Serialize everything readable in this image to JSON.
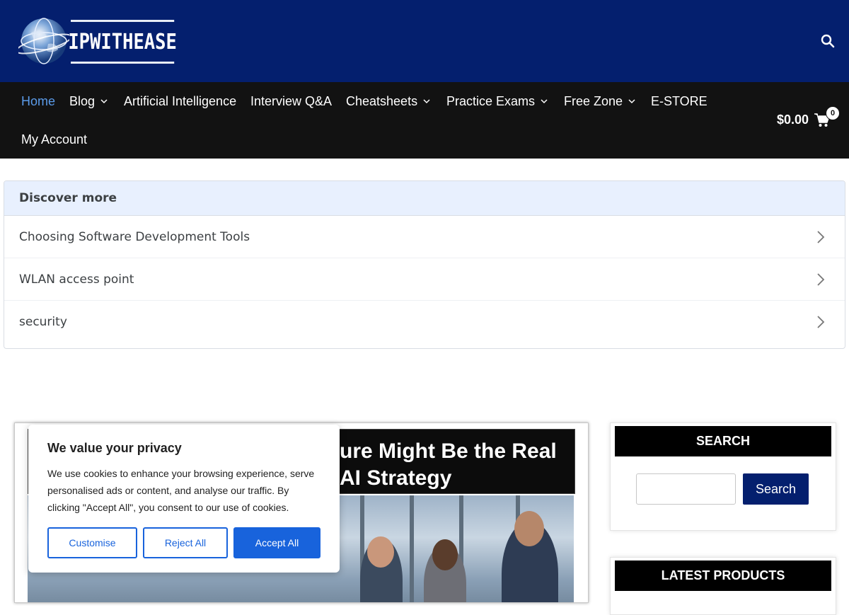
{
  "brand": {
    "name": "IPWITHEASE"
  },
  "nav": {
    "items": [
      {
        "label": "Home",
        "active": true,
        "dropdown": false
      },
      {
        "label": "Blog",
        "dropdown": true
      },
      {
        "label": "Artificial Intelligence",
        "dropdown": false
      },
      {
        "label": "Interview Q&A",
        "dropdown": false
      },
      {
        "label": "Cheatsheets",
        "dropdown": true
      },
      {
        "label": "Practice Exams",
        "dropdown": true
      },
      {
        "label": "Free Zone",
        "dropdown": true
      },
      {
        "label": "E-STORE",
        "dropdown": false
      },
      {
        "label": "My Account",
        "dropdown": false
      }
    ],
    "cart_total": "$0.00",
    "cart_count": "0"
  },
  "discover": {
    "title": "Discover more",
    "items": [
      "Choosing Software Development Tools",
      "WLAN access point",
      "security"
    ]
  },
  "article": {
    "title_line1": "ure Might Be the Real",
    "title_line2": "AI Strategy"
  },
  "cookie": {
    "title": "We value your privacy",
    "text": "We use cookies to enhance your browsing experience, serve personalised ads or content, and analyse our traffic. By clicking \"Accept All\", you consent to our use of cookies.",
    "customise": "Customise",
    "reject": "Reject All",
    "accept": "Accept All"
  },
  "sidebar": {
    "search_title": "SEARCH",
    "search_button": "Search",
    "products_title": "LATEST PRODUCTS"
  },
  "colors": {
    "header_bg": "#041f6e",
    "nav_bg": "#121212",
    "active_link": "#5b9be9",
    "cookie_accent": "#1863dc"
  }
}
